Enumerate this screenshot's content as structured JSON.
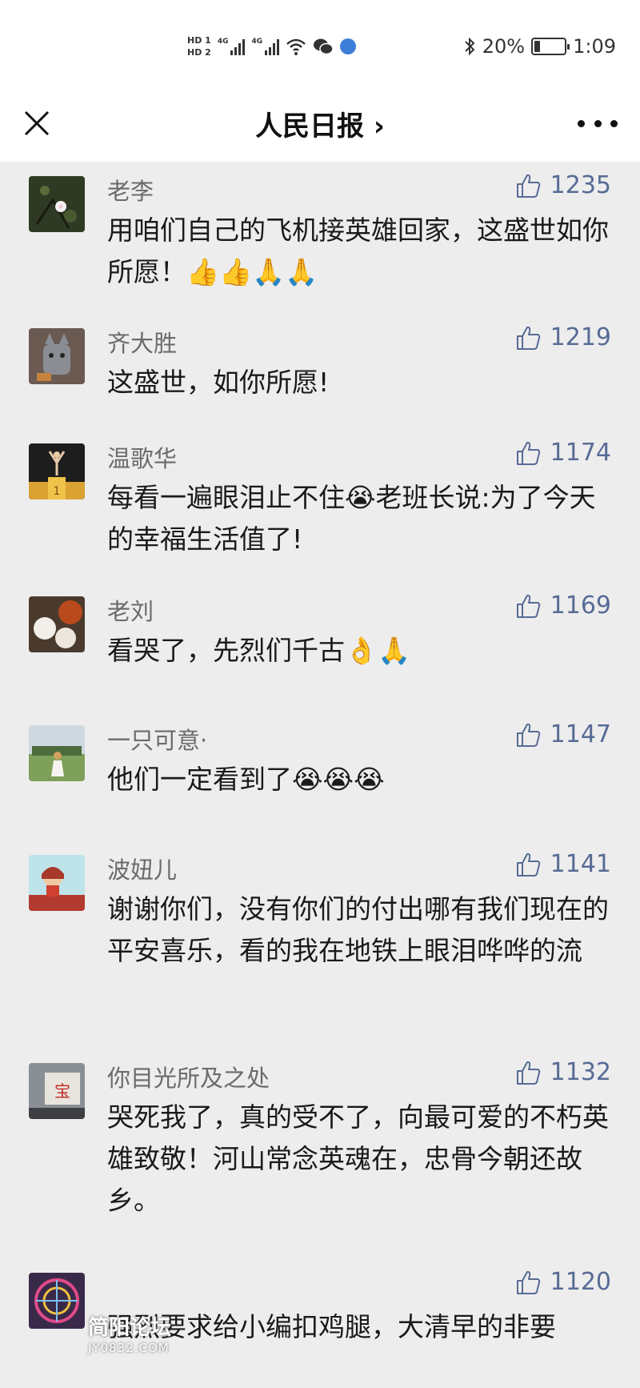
{
  "status_bar": {
    "hd_1": "HD 1",
    "hd_2": "HD 2",
    "net_1": "4G",
    "net_2": "4G",
    "battery": "20%",
    "time": "1:09",
    "icons": [
      "hd-icon",
      "signal-icon",
      "wifi-icon",
      "wechat-icon",
      "globe-icon",
      "bluetooth-icon",
      "battery-icon"
    ],
    "battery_level": 0.2
  },
  "navbar": {
    "title": "人民日报 ›",
    "close_icon": "close-icon",
    "more_icon": "more-icon"
  },
  "comments": [
    {
      "name": "老李",
      "likes": "1235",
      "text": "用咱们自己的飞机接英雄回家，这盛世如你所愿！👍👍🙏🙏"
    },
    {
      "name": "齐大胜",
      "likes": "1219",
      "text": "这盛世，如你所愿!"
    },
    {
      "name": "温歌华",
      "likes": "1174",
      "text": "每看一遍眼泪止不住😭老班长说:为了今天的幸福生活值了!"
    },
    {
      "name": "老刘",
      "likes": "1169",
      "text": "看哭了，先烈们千古👌🙏"
    },
    {
      "name": "一只可意·",
      "likes": "1147",
      "text": "他们一定看到了😭😭😭"
    },
    {
      "name": "波妞儿",
      "likes": "1141",
      "text": "谢谢你们，没有你们的付出哪有我们现在的平安喜乐，看的我在地铁上眼泪哗哗的流"
    },
    {
      "name": "你目光所及之处",
      "likes": "1132",
      "text": "哭死我了，真的受不了，向最可爱的不朽英雄致敬！河山常念英魂在，忠骨今朝还故乡。"
    },
    {
      "name": "",
      "likes": "1120",
      "text": "强烈要求给小编扣鸡腿，大清早的非要"
    }
  ],
  "avatar_texts": {
    "podium": "1",
    "sign": "宝"
  },
  "watermark": {
    "line1": "简阳论坛",
    "line2": "JY0832.COM"
  },
  "colors": {
    "like_blue": "#576b95",
    "background": "#ededed",
    "name_gray": "#6b6b6b"
  }
}
